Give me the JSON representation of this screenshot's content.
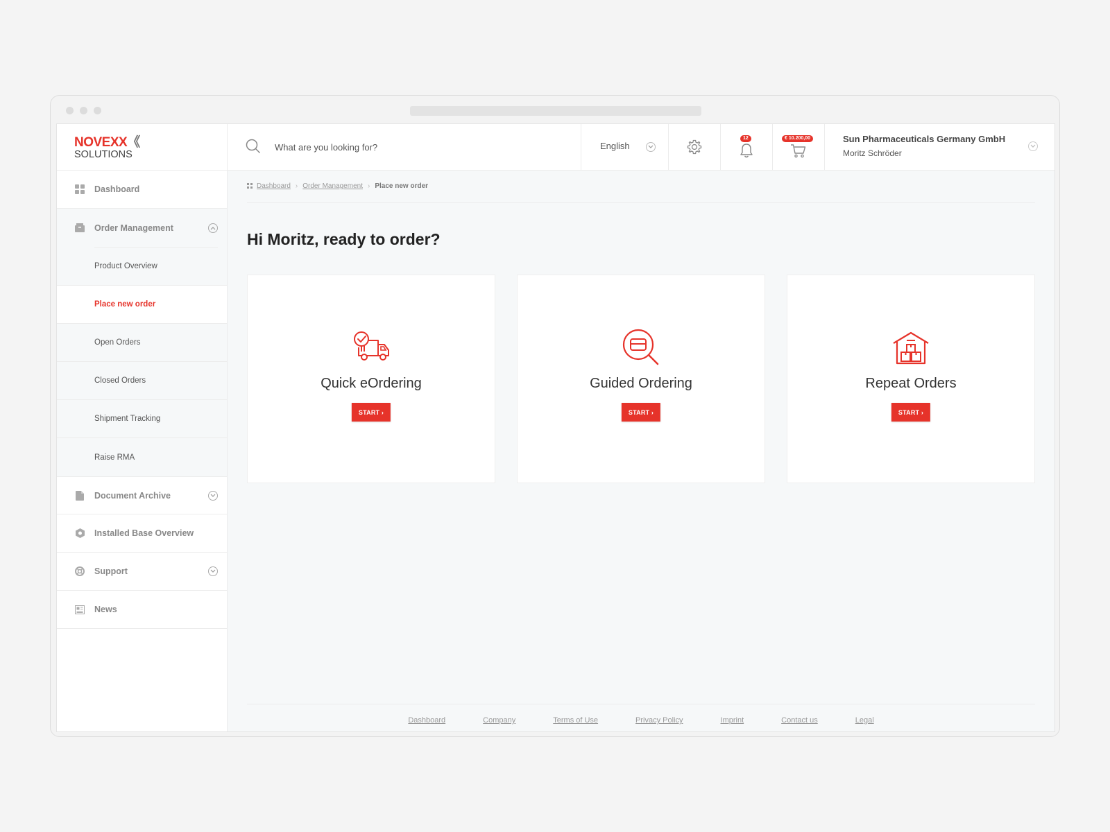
{
  "brand": {
    "logo_top": "NOVEXX",
    "logo_chevrons": "《",
    "logo_bottom": "SOLUTIONS",
    "accent_color": "#e6332a"
  },
  "sidebar": {
    "items": [
      {
        "label": "Dashboard",
        "icon": "grid-icon"
      },
      {
        "label": "Order Management",
        "icon": "box-icon",
        "expanded": true,
        "children": [
          {
            "label": "Product Overview"
          },
          {
            "label": "Place new order",
            "active": true
          },
          {
            "label": "Open Orders"
          },
          {
            "label": "Closed Orders"
          },
          {
            "label": "Shipment Tracking"
          },
          {
            "label": "Raise RMA"
          }
        ]
      },
      {
        "label": "Document Archive",
        "icon": "document-icon",
        "expandable": true
      },
      {
        "label": "Installed Base Overview",
        "icon": "hexagon-icon"
      },
      {
        "label": "Support",
        "icon": "lifebuoy-icon",
        "expandable": true
      },
      {
        "label": "News",
        "icon": "newspaper-icon"
      }
    ]
  },
  "header": {
    "search_placeholder": "What are you looking for?",
    "language": "English",
    "notifications_count": "12",
    "cart_total": "€ 10.200,00",
    "company": "Sun Pharmaceuticals Germany GmbH",
    "user": "Moritz Schröder"
  },
  "breadcrumb": {
    "items": [
      "Dashboard",
      "Order Management"
    ],
    "current": "Place new order"
  },
  "main": {
    "greeting": "Hi Moritz, ready to order?",
    "cards": [
      {
        "title": "Quick eOrdering",
        "button": "START ›",
        "icon": "delivery-truck-icon"
      },
      {
        "title": "Guided Ordering",
        "button": "START ›",
        "icon": "search-card-icon"
      },
      {
        "title": "Repeat Orders",
        "button": "START ›",
        "icon": "warehouse-icon"
      }
    ]
  },
  "footer": {
    "links": [
      "Dashboard",
      "Company",
      "Terms of Use",
      "Privacy Policy",
      "Imprint",
      "Contact us",
      "Legal"
    ]
  }
}
